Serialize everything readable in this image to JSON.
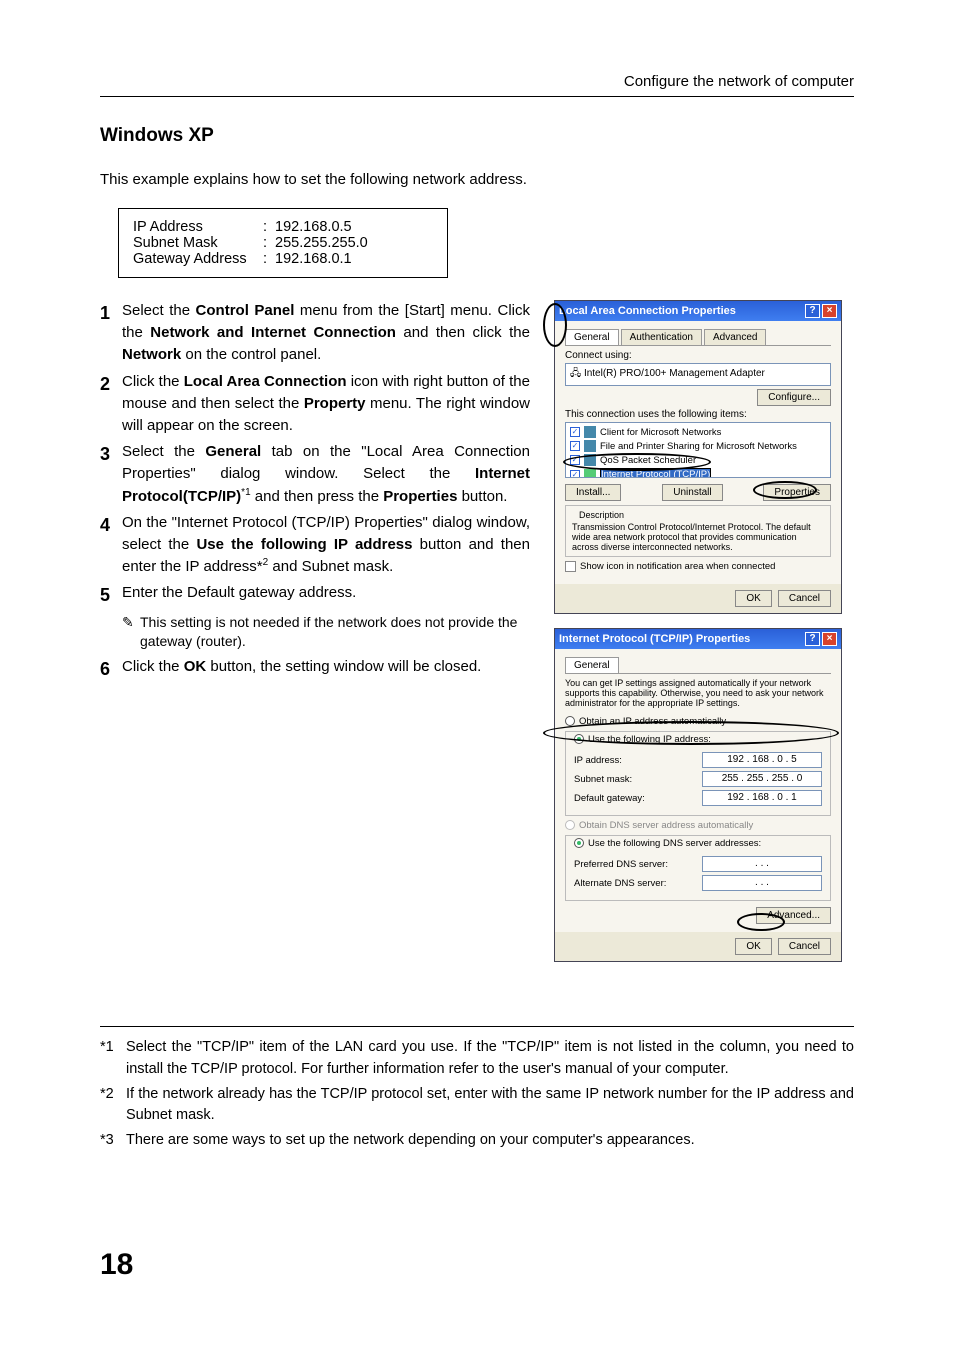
{
  "breadcrumb": "Configure the network of computer",
  "heading": "Windows XP",
  "intro": "This example explains how to set the following network address.",
  "addr": {
    "ip_k": "IP Address",
    "ip_v": "192.168.0.5",
    "sm_k": "Subnet Mask",
    "sm_v": "255.255.255.0",
    "gw_k": "Gateway Address",
    "gw_v": "192.168.0.1"
  },
  "steps": {
    "s1a": "Select the ",
    "s1b": "Control Panel",
    "s1c": " menu from the [Start] menu. Click the ",
    "s1d": "Network and Internet Connection",
    "s1e": " and then click the ",
    "s1f": "Network",
    "s1g": " on the control panel.",
    "s2a": "Click the ",
    "s2b": "Local Area Connection",
    "s2c": " icon with right button of the mouse and then select the ",
    "s2d": "Property",
    "s2e": " menu. The right window will appear on the screen.",
    "s3a": "Select the ",
    "s3b": "General",
    "s3c": " tab on the \"Local Area Connection Properties\" dialog window. Select the ",
    "s3d": "Internet Protocol(TCP/IP)",
    "s3e": " and then press the ",
    "s3f": "Properties",
    "s3g": " button.",
    "s3sup": "*1",
    "s4a": "On the \"Internet Protocol (TCP/IP) Properties\" dialog window, select the ",
    "s4b": "Use the following IP address",
    "s4c": " button and then enter the IP address*",
    "s4d": " and Subnet mask.",
    "s4sup": "2",
    "s5": "Enter the Default gateway address.",
    "s5note": "This setting is not needed if the network does not provide the gateway (router).",
    "s6a": "Click the ",
    "s6b": "OK",
    "s6c": " button, the setting window will be closed."
  },
  "dialog1": {
    "title": "Local Area Connection Properties",
    "tab_general": "General",
    "tab_auth": "Authentication",
    "tab_adv": "Advanced",
    "connect_using": "Connect using:",
    "adapter": "Intel(R) PRO/100+ Management Adapter",
    "configure": "Configure...",
    "uses_items": "This connection uses the following items:",
    "item1": "Client for Microsoft Networks",
    "item2": "File and Printer Sharing for Microsoft Networks",
    "item3": "QoS Packet Scheduler",
    "item4": "Internet Protocol (TCP/IP)",
    "install": "Install...",
    "uninstall": "Uninstall",
    "properties": "Properties",
    "desc_h": "Description",
    "desc": "Transmission Control Protocol/Internet Protocol. The default wide area network protocol that provides communication across diverse interconnected networks.",
    "show_icon": "Show icon in notification area when connected",
    "ok": "OK",
    "cancel": "Cancel"
  },
  "dialog2": {
    "title": "Internet Protocol (TCP/IP) Properties",
    "tab_general": "General",
    "blurb": "You can get IP settings assigned automatically if your network supports this capability. Otherwise, you need to ask your network administrator for the appropriate IP settings.",
    "obtain_ip": "Obtain an IP address automatically",
    "use_ip": "Use the following IP address:",
    "ip_l": "IP address:",
    "ip_v": "192 . 168 .   0  .   5",
    "sm_l": "Subnet mask:",
    "sm_v": "255 . 255 . 255 .   0",
    "gw_l": "Default gateway:",
    "gw_v": "192 . 168 .   0  .   1",
    "obtain_dns": "Obtain DNS server address automatically",
    "use_dns": "Use the following DNS server addresses:",
    "pref_dns": "Preferred DNS server:",
    "alt_dns": "Alternate DNS server:",
    "advanced": "Advanced...",
    "ok": "OK",
    "cancel": "Cancel",
    "dots": ".       .       ."
  },
  "footnotes": {
    "f1k": "*1",
    "f1": "Select the \"TCP/IP\" item of the LAN card you use. If the \"TCP/IP\" item is not listed in the column, you need to install the TCP/IP protocol. For further information refer to the user's manual of your computer.",
    "f2k": "*2",
    "f2": "If the network already has the TCP/IP protocol set, enter with the same IP network number for the IP address and Subnet mask.",
    "f3k": "*3",
    "f3": "There are some ways to set up the network depending on your computer's appearances."
  },
  "pagenum": "18",
  "pencil": "✎",
  "checkmark": "✓"
}
